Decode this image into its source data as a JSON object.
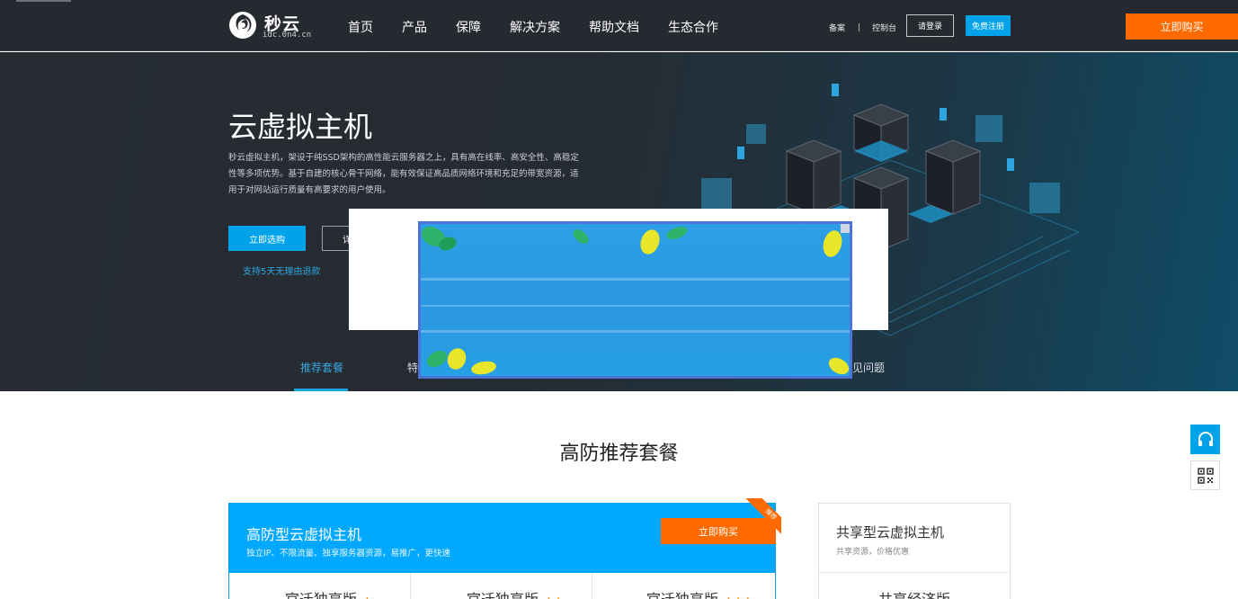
{
  "brand": {
    "name": "秒云",
    "domain": "idc.0n4.cn"
  },
  "nav": {
    "items": [
      "首页",
      "产品",
      "保障",
      "解决方案",
      "帮助文档",
      "生态合作"
    ]
  },
  "toplinks": {
    "beian": "备案",
    "separator": "|",
    "console": "控制台",
    "login": "请登录",
    "register": "免费注册",
    "buy_now": "立即购买"
  },
  "hero": {
    "title": "云虚拟主机",
    "description": "秒云虚拟主机，架设于纯SSD架构的高性能云服务器之上，具有高在线率、高安全性、高稳定性等多项优势。基于自建的核心骨干网络，能有效保证高品质网络环境和充足的带宽资源，适用于对网站运行质量有高要求的用户使用。",
    "select_button": "立即选购",
    "detail_button": "详",
    "refund_note": "支持5天无理由退款",
    "tabs": [
      "推荐套餐",
      "特",
      "见问题"
    ]
  },
  "section": {
    "title": "高防推荐套餐",
    "main_package": {
      "name": "高防型云虚拟主机",
      "subtitle": "独立IP、不限流量、独享服务器资源，易推广，更快速",
      "buy_button": "立即购买",
      "badge": "推荐",
      "tiers": [
        {
          "name": "官迁独享版",
          "stars": "★"
        },
        {
          "name": "官迁独享版",
          "stars": "★★"
        },
        {
          "name": "官迁独享版",
          "stars": "★★★"
        }
      ]
    },
    "side_package": {
      "name": "共享型云虚拟主机",
      "subtitle": "共享资源，价格优惠",
      "tier": "共享经济版"
    }
  },
  "floating": {
    "support_icon": "headset-icon",
    "qr_icon": "qr-code-icon"
  },
  "colors": {
    "accent": "#00a3ea",
    "buy": "#ff6a00",
    "nav_bg": "#262a30"
  }
}
